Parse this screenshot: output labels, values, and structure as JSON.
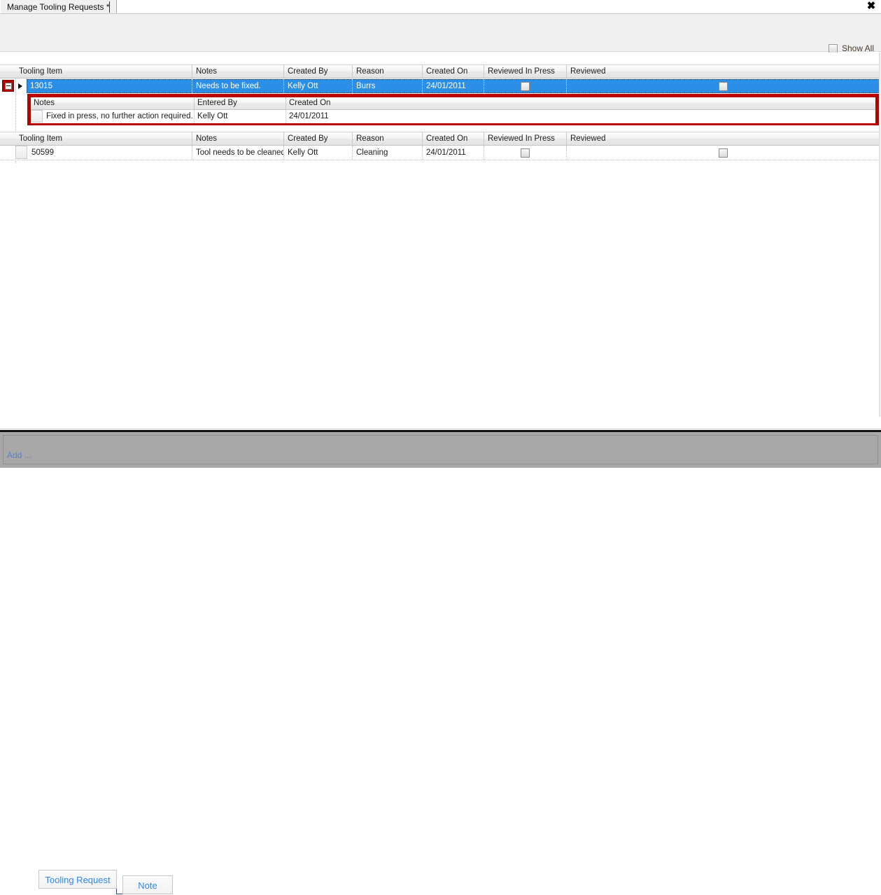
{
  "window": {
    "tab_title": "Manage Tooling Requests *",
    "close_icon": "close-icon"
  },
  "command_bar": {
    "show_all_label": "Show All",
    "show_all_checked": false
  },
  "main_grid": {
    "columns": [
      "Tooling Item",
      "Notes",
      "Created By",
      "Reason",
      "Created On",
      "Reviewed In Press",
      "Reviewed"
    ],
    "rows": [
      {
        "tooling_item": "13015",
        "notes": "Needs to be fixed.",
        "created_by": "Kelly Ott",
        "reason": "Burrs",
        "created_on": "24/01/2011",
        "reviewed_in_press": false,
        "reviewed": false,
        "selected": true,
        "expanded": true
      },
      {
        "tooling_item": "50599",
        "notes": "Tool needs to be cleaned",
        "created_by": "Kelly Ott",
        "reason": "Cleaning",
        "created_on": "24/01/2011",
        "reviewed_in_press": false,
        "reviewed": false,
        "selected": false,
        "expanded": false
      }
    ]
  },
  "detail_grid": {
    "columns": [
      "Notes",
      "Entered By",
      "Created On"
    ],
    "rows": [
      {
        "notes": "Fixed in press, no further action required.",
        "entered_by": "Kelly Ott",
        "created_on": "24/01/2011"
      }
    ],
    "highlight_color": "#bb0000"
  },
  "bottom_toolbar": {
    "add_label": "Add ...",
    "buttons": [
      {
        "label": "Tooling Request"
      },
      {
        "label": "Note"
      }
    ]
  },
  "colors": {
    "selection_blue": "#2b8fe8",
    "highlight_red": "#bb0000",
    "toolbar_gray": "#a8a8a8",
    "link_blue": "#2f86e8"
  }
}
